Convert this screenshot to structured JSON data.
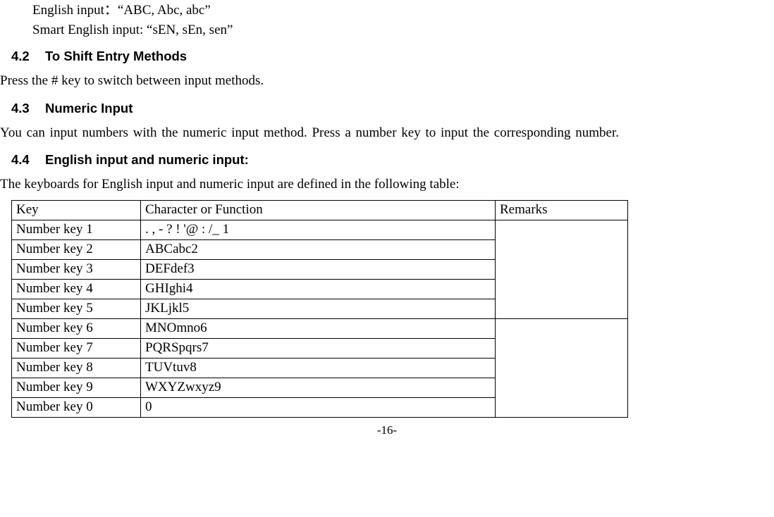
{
  "intro": {
    "english_input_label": "English input",
    "english_input_sep": "：",
    "english_input_value": "“ABC, Abc, abc”",
    "smart_english_label": "Smart English input:",
    "smart_english_value": " “sEN, sEn, sen”"
  },
  "sections": {
    "s42_num": "4.2",
    "s42_title": "To Shift Entry Methods",
    "s42_body": "Press the # key to switch between input methods.",
    "s43_num": "4.3",
    "s43_title": "Numeric Input",
    "s43_body": "You can input numbers with the numeric input method. Press a number key to input the corresponding number.",
    "s44_num": "4.4",
    "s44_title": "English input and numeric input:",
    "s44_body": "The keyboards for English input and numeric input are defined in the following table:"
  },
  "table": {
    "headers": {
      "key": "Key",
      "char": "Character or Function",
      "remarks": "Remarks"
    },
    "rows": [
      {
        "key": "Number key 1",
        "char": ". , - ? ! '@ : /_ 1"
      },
      {
        "key": "Number key 2",
        "char": "ABCabc2"
      },
      {
        "key": "Number key 3",
        "char": "DEFdef3"
      },
      {
        "key": "Number key 4",
        "char": "GHIghi4"
      },
      {
        "key": "Number key 5",
        "char": "JKLjkl5"
      },
      {
        "key": "Number key 6",
        "char": "MNOmno6"
      },
      {
        "key": "Number key 7",
        "char": "PQRSpqrs7"
      },
      {
        "key": "Number key 8",
        "char": "TUVtuv8"
      },
      {
        "key": "Number key 9",
        "char": "WXYZwxyz9"
      },
      {
        "key": "Number key 0",
        "char": "0"
      }
    ],
    "remarks_group1": "",
    "remarks_group2": ""
  },
  "footer": {
    "page_number": "-16-"
  }
}
